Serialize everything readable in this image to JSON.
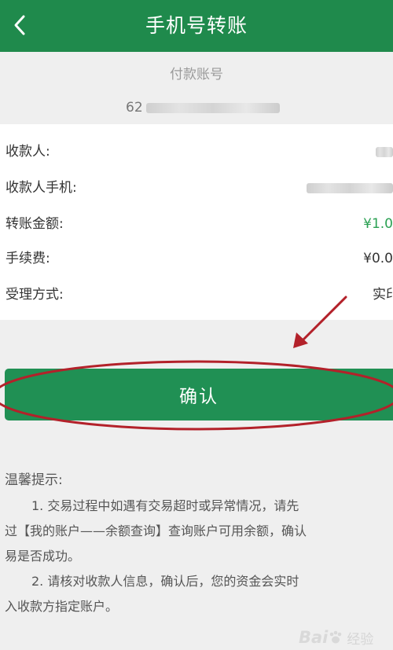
{
  "header": {
    "title": "手机号转账",
    "back_icon": "chevron-left-icon"
  },
  "payer": {
    "label": "付款账号",
    "account_prefix": "62"
  },
  "details": [
    {
      "label": "收款人:",
      "value": ""
    },
    {
      "label": "收款人手机:",
      "value": ""
    },
    {
      "label": "转账金额:",
      "value": "¥1.0"
    },
    {
      "label": "手续费:",
      "value": "¥0.0"
    },
    {
      "label": "受理方式:",
      "value": "实印"
    }
  ],
  "confirm_button": {
    "label": "确认"
  },
  "tips": {
    "title": "温馨提示:",
    "lines": [
      "1. 交易过程中如遇有交易超时或异常情况，请先",
      "过【我的账户——余额查询】查询账户可用余额，确认",
      "易是否成功。",
      "2. 请核对收款人信息，确认后，您的资金会实时",
      "入收款方指定账户。"
    ]
  },
  "watermark": {
    "logo": "Bai",
    "suffix": "经验"
  },
  "colors": {
    "header": "#1f8a4c",
    "button": "#209054",
    "amount": "#2aa052",
    "annotation": "#b3212a"
  }
}
